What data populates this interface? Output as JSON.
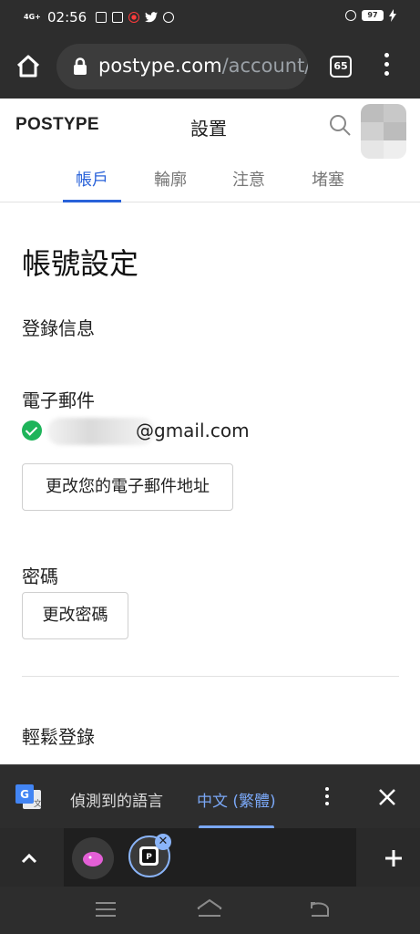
{
  "status_bar": {
    "network": "4G+",
    "time": "02:56",
    "battery": "97",
    "icons": [
      "mail-icon",
      "instagram-icon",
      "recording-icon",
      "twitter-icon",
      "alarm-icon"
    ]
  },
  "browser": {
    "url_host": "postype.com",
    "url_path": "/account/s",
    "tab_count": "65"
  },
  "site": {
    "logo": "POSTYPE",
    "title": "設置",
    "tabs": [
      {
        "label": "帳戶",
        "active": true
      },
      {
        "label": "輪廓",
        "active": false
      },
      {
        "label": "注意",
        "active": false
      },
      {
        "label": "堵塞",
        "active": false
      }
    ]
  },
  "content": {
    "heading": "帳號設定",
    "login_info": "登錄信息",
    "email_label": "電子郵件",
    "email_domain": "@gmail.com",
    "change_email_button": "更改您的電子郵件地址",
    "password_label": "密碼",
    "change_password_button": "更改密碼",
    "easy_login": "輕鬆登錄"
  },
  "translate_bar": {
    "detected": "偵測到的語言",
    "target": "中文 (繁體)"
  },
  "colors": {
    "accent": "#2962d9",
    "success": "#1eb45a",
    "chrome_bg": "#2d2d2d",
    "translate_accent": "#7aa7f5"
  }
}
